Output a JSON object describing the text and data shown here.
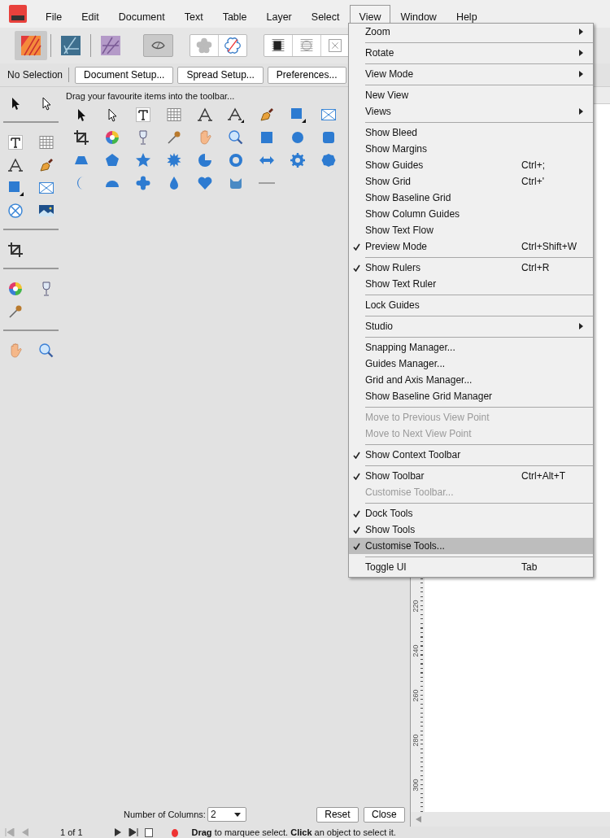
{
  "menubar": [
    {
      "label": "File",
      "selected": false
    },
    {
      "label": "Edit",
      "selected": false
    },
    {
      "label": "Document",
      "selected": false
    },
    {
      "label": "Text",
      "selected": false
    },
    {
      "label": "Table",
      "selected": false
    },
    {
      "label": "Layer",
      "selected": false
    },
    {
      "label": "Select",
      "selected": false
    },
    {
      "label": "View",
      "selected": true
    },
    {
      "label": "Window",
      "selected": false
    },
    {
      "label": "Help",
      "selected": false
    }
  ],
  "context_toolbar": {
    "selection": "No Selection",
    "buttons": [
      "Document Setup...",
      "Spread Setup...",
      "Preferences..."
    ]
  },
  "customise_tools": {
    "hint": "Drag your favourite items into the toolbar...",
    "columns_label": "Number of Columns:",
    "columns_value": "2",
    "buttons": [
      "Reset",
      "Close"
    ]
  },
  "ruler": {
    "labels": [
      "220",
      "240",
      "260",
      "280",
      "300"
    ]
  },
  "view_menu": [
    [
      {
        "label": "Zoom",
        "checked": false,
        "disabled": false,
        "submenu": true,
        "selected": false
      }
    ],
    [
      {
        "label": "Rotate",
        "checked": false,
        "disabled": false,
        "submenu": true,
        "selected": false
      }
    ],
    [
      {
        "label": "View Mode",
        "checked": false,
        "disabled": false,
        "submenu": true,
        "selected": false
      }
    ],
    [
      {
        "label": "New View",
        "checked": false,
        "disabled": false,
        "submenu": false,
        "selected": false
      },
      {
        "label": "Views",
        "checked": false,
        "disabled": false,
        "submenu": true,
        "selected": false
      }
    ],
    [
      {
        "label": "Show Bleed",
        "checked": false,
        "disabled": false,
        "submenu": false,
        "selected": false
      },
      {
        "label": "Show Margins",
        "checked": false,
        "disabled": false,
        "submenu": false,
        "selected": false
      },
      {
        "label": "Show Guides",
        "shortcut": "Ctrl+;",
        "checked": false,
        "disabled": false,
        "submenu": false,
        "selected": false
      },
      {
        "label": "Show Grid",
        "shortcut": "Ctrl+'",
        "checked": false,
        "disabled": false,
        "submenu": false,
        "selected": false
      },
      {
        "label": "Show Baseline Grid",
        "checked": false,
        "disabled": false,
        "submenu": false,
        "selected": false
      },
      {
        "label": "Show Column Guides",
        "checked": false,
        "disabled": false,
        "submenu": false,
        "selected": false
      },
      {
        "label": "Show Text Flow",
        "checked": false,
        "disabled": false,
        "submenu": false,
        "selected": false
      },
      {
        "label": "Preview Mode",
        "shortcut": "Ctrl+Shift+W",
        "checked": true,
        "disabled": false,
        "submenu": false,
        "selected": false
      }
    ],
    [
      {
        "label": "Show Rulers",
        "shortcut": "Ctrl+R",
        "checked": true,
        "disabled": false,
        "submenu": false,
        "selected": false
      },
      {
        "label": "Show Text Ruler",
        "checked": false,
        "disabled": false,
        "submenu": false,
        "selected": false
      }
    ],
    [
      {
        "label": "Lock Guides",
        "checked": false,
        "disabled": false,
        "submenu": false,
        "selected": false
      }
    ],
    [
      {
        "label": "Studio",
        "checked": false,
        "disabled": false,
        "submenu": true,
        "selected": false
      }
    ],
    [
      {
        "label": "Snapping Manager...",
        "checked": false,
        "disabled": false,
        "submenu": false,
        "selected": false
      },
      {
        "label": "Guides Manager...",
        "checked": false,
        "disabled": false,
        "submenu": false,
        "selected": false
      },
      {
        "label": "Grid and Axis Manager...",
        "checked": false,
        "disabled": false,
        "submenu": false,
        "selected": false
      },
      {
        "label": "Show Baseline Grid Manager",
        "checked": false,
        "disabled": false,
        "submenu": false,
        "selected": false
      }
    ],
    [
      {
        "label": "Move to Previous View Point",
        "checked": false,
        "disabled": true,
        "submenu": false,
        "selected": false
      },
      {
        "label": "Move to Next View Point",
        "checked": false,
        "disabled": true,
        "submenu": false,
        "selected": false
      }
    ],
    [
      {
        "label": "Show Context Toolbar",
        "checked": true,
        "disabled": false,
        "submenu": false,
        "selected": false
      }
    ],
    [
      {
        "label": "Show Toolbar",
        "shortcut": "Ctrl+Alt+T",
        "checked": true,
        "disabled": false,
        "submenu": false,
        "selected": false
      },
      {
        "label": "Customise Toolbar...",
        "checked": false,
        "disabled": true,
        "submenu": false,
        "selected": false
      }
    ],
    [
      {
        "label": "Dock Tools",
        "checked": true,
        "disabled": false,
        "submenu": false,
        "selected": false
      },
      {
        "label": "Show Tools",
        "checked": true,
        "disabled": false,
        "submenu": false,
        "selected": false
      },
      {
        "label": "Customise Tools...",
        "checked": true,
        "disabled": false,
        "submenu": false,
        "selected": true
      }
    ],
    [
      {
        "label": "Toggle UI",
        "shortcut": "Tab",
        "checked": false,
        "disabled": false,
        "submenu": false,
        "selected": false
      }
    ]
  ],
  "status_bar": {
    "page": "1 of 1",
    "hint": "**Drag** to marquee select. **Click** an object to select it."
  }
}
